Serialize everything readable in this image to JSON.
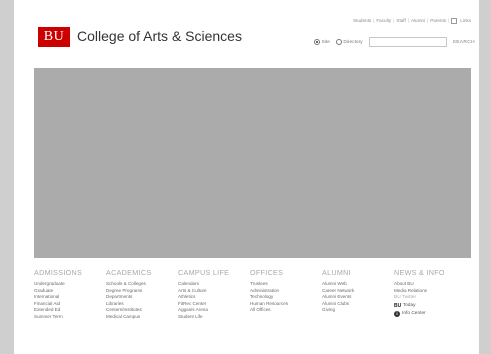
{
  "header": {
    "logo_text": "BU",
    "college_name": "College of Arts & Sciences",
    "utility_links": [
      "Students",
      "Faculty",
      "Staff",
      "Alumni",
      "Parents"
    ],
    "links_label": "Links",
    "search": {
      "option_site": "Site",
      "option_directory": "Directory",
      "input_value": "",
      "button_label": "SEARCH"
    }
  },
  "footer": {
    "columns": [
      {
        "title": "ADMISSIONS",
        "items": [
          "Undergraduate",
          "Graduate",
          "International",
          "Financial Aid",
          "Extended Ed",
          "Summer Term"
        ]
      },
      {
        "title": "ACADEMICS",
        "items": [
          "Schools & Colleges",
          "Degree Programs",
          "Departments",
          "Libraries",
          "Centers/Institutes",
          "Medical Campus"
        ]
      },
      {
        "title": "CAMPUS LIFE",
        "items": [
          "Calendars",
          "Arts & Culture",
          "Athletics",
          "FitRec Center",
          "Agganis Arena",
          "Student Life"
        ]
      },
      {
        "title": "OFFICES",
        "items": [
          "Trustees",
          "Administration",
          "Technology",
          "Human Resources",
          "All Offices"
        ]
      },
      {
        "title": "ALUMNI",
        "items": [
          "Alumni Web",
          "Career Network",
          "Alumni Events",
          "Alumni Clubs",
          "Giving"
        ]
      },
      {
        "title": "NEWS & INFO",
        "items": [
          "About BU",
          "Media Relations"
        ]
      }
    ],
    "news_extras": {
      "twitter_label": "BU Twitter",
      "bu_today_brand": "BU",
      "bu_today_label": "Today",
      "info_center_label": "Info Center"
    }
  }
}
